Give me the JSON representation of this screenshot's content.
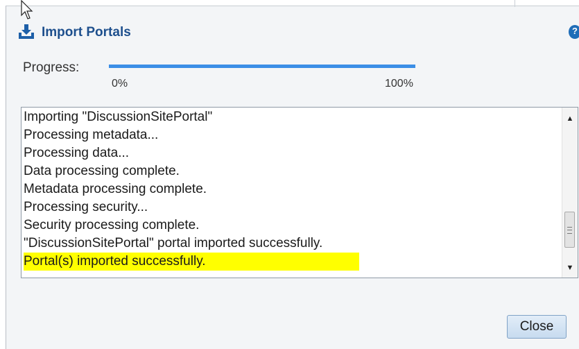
{
  "dialog": {
    "title": "Import Portals",
    "help_glyph": "?",
    "title_icon": "import-download-icon"
  },
  "progress": {
    "label": "Progress:",
    "min_label": "0%",
    "max_label": "100%",
    "value_percent": 100,
    "color": "#3b8ee6"
  },
  "log": {
    "lines": [
      "Importing \"DiscussionSitePortal\"",
      "Processing metadata...",
      "Processing data...",
      "Data processing complete.",
      "Metadata processing complete.",
      "Processing security...",
      "Security processing complete.",
      "\"DiscussionSitePortal\" portal imported successfully.",
      "Portal(s) imported successfully."
    ],
    "highlight_color": "#ffff00"
  },
  "buttons": {
    "close_label": "Close"
  }
}
